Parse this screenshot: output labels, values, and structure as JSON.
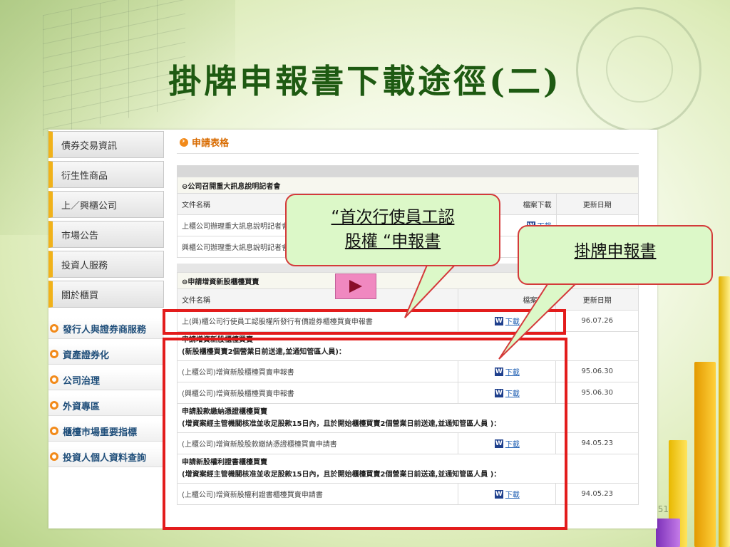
{
  "slide": {
    "title": "掛牌申報書下載途徑(二)",
    "page_number": "51"
  },
  "sidebar": {
    "items": [
      {
        "label": "債券交易資訊"
      },
      {
        "label": "衍生性商品"
      },
      {
        "label": "上／興櫃公司"
      },
      {
        "label": "市場公告"
      },
      {
        "label": "投資人服務"
      },
      {
        "label": "關於櫃買"
      }
    ],
    "links": [
      {
        "label": "發行人與證券商服務"
      },
      {
        "label": "資產證券化"
      },
      {
        "label": "公司治理"
      },
      {
        "label": "外資專區"
      },
      {
        "label": "櫃檯市場重要指標"
      },
      {
        "label": "投資人個人資料查詢"
      }
    ]
  },
  "content": {
    "section_title": "申請表格",
    "group1": {
      "title": "⊖公司召開重大訊息說明記者會",
      "headers": {
        "name": "文件名稱",
        "download": "檔案下載",
        "date": "更新日期"
      },
      "rows": [
        {
          "name": "上櫃公司辦理重大訊息說明記者會申請書",
          "link": "下載",
          "date": ""
        },
        {
          "name": "興櫃公司辦理重大訊息說明記者會申請書",
          "link": "下載",
          "date": ""
        }
      ]
    },
    "group2": {
      "title": "⊖申請增資新股櫃檯買賣",
      "headers": {
        "name": "文件名稱",
        "download": "檔案下載",
        "date": "更新日期"
      },
      "row1": {
        "name": "上(興)櫃公司行使員工認股權所發行有價證券櫃檯買賣申報書",
        "link": "下載",
        "date": "96.07.26"
      },
      "note1": {
        "line1": "申請增資新股櫃檯買賣",
        "line2": "(新股櫃檯買賣2個營業日前送達,並通知管區人員)："
      },
      "row2": {
        "name": "(上櫃公司)增資新股櫃檯買賣申報書",
        "link": "下載",
        "date": "95.06.30"
      },
      "row3": {
        "name": "(興櫃公司)增資新股櫃檯買賣申報書",
        "link": "下載",
        "date": "95.06.30"
      },
      "note2": {
        "line1": "申請股款繳納憑證櫃檯買賣",
        "line2": "(增資案經主管機關核准並收足股款15日內，且於開始櫃檯買賣2個營業日前送達,並通知管區人員 )："
      },
      "row4": {
        "name": "(上櫃公司)增資新股股款繳納憑證櫃檯買賣申請書",
        "link": "下載",
        "date": "94.05.23"
      },
      "note3": {
        "line1": "申請新股權利證書櫃檯買賣",
        "line2": "(增資案經主管機關核准並收足股款15日內，且於開始櫃檯買賣2個營業日前送達,並通知管區人員 )："
      },
      "row5": {
        "name": "(上櫃公司)增資新股權利證書櫃檯買賣申請書",
        "link": "下載",
        "date": "94.05.23"
      }
    }
  },
  "callouts": {
    "left": {
      "line1": "“首次行使員工認",
      "line2": "股權 “申報書"
    },
    "right": {
      "text": "掛牌申報書"
    }
  },
  "colors": {
    "title": "#1e5a12",
    "highlight_box": "#e31c1c",
    "callout_bg": "#dcf8c8"
  }
}
